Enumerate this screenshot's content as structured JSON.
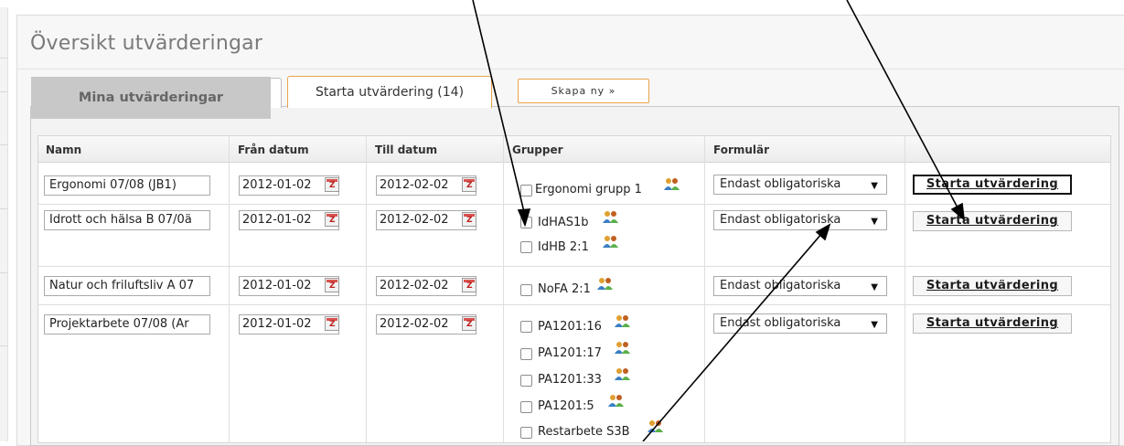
{
  "page": {
    "title": "Översikt utvärderingar"
  },
  "tabs": {
    "mine": "Mina utvärderingar",
    "start": "Starta utvärdering (14)",
    "new": "Skapa ny »"
  },
  "table": {
    "columns": [
      "Namn",
      "Från datum",
      "Till datum",
      "Grupper",
      "Formulär",
      ""
    ],
    "rows": [
      {
        "name": "Ergonomi 07/08 (JB1)",
        "from": "2012-01-02",
        "to": "2012-02-02",
        "groups": [
          "Ergonomi grupp 1"
        ],
        "form": "Endast obligatoriska",
        "action": "Starta utvärdering"
      },
      {
        "name": "Idrott och hälsa B 07/0ä",
        "from": "2012-01-02",
        "to": "2012-02-02",
        "groups": [
          "IdHAS1b",
          "IdHB 2:1"
        ],
        "form": "Endast obligatoriska",
        "action": "Starta utvärdering"
      },
      {
        "name": "Natur och friluftsliv A 07",
        "from": "2012-01-02",
        "to": "2012-02-02",
        "groups": [
          "NoFA 2:1"
        ],
        "form": "Endast obligatoriska",
        "action": "Starta utvärdering"
      },
      {
        "name": "Projektarbete 07/08 (Ar",
        "from": "2012-01-02",
        "to": "2012-02-02",
        "groups": [
          "PA1201:16",
          "PA1201:17",
          "PA1201:33",
          "PA1201:5",
          "Restarbete S3B"
        ],
        "form": "Endast obligatoriska",
        "action": "Starta utvärdering"
      }
    ]
  },
  "icons": {
    "calendar": "calendar-icon",
    "group": "group-people-icon",
    "dropdown": "chevron-down-icon"
  },
  "colors": {
    "tab_accent": "#e8a44a",
    "annotation_arrow": "#000000"
  }
}
